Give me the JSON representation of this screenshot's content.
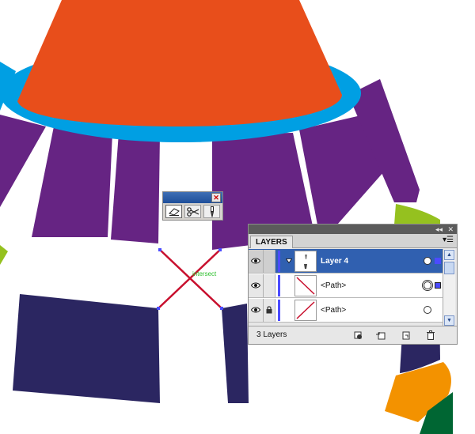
{
  "canvas": {
    "intersect_hint": "intersect",
    "colors": {
      "orange": "#e84e1b",
      "blue_ring": "#009fe3",
      "purple": "#662483",
      "navy": "#2b2661",
      "green": "#95c11f",
      "gold": "#f39200",
      "dark_green": "#006633",
      "crossed_lines": "#c8102e"
    }
  },
  "tool_panel": {
    "tools": [
      {
        "icon": "eraser-icon",
        "active": true
      },
      {
        "icon": "scissors-icon",
        "active": false
      },
      {
        "icon": "knife-icon",
        "active": false
      }
    ]
  },
  "layers_panel": {
    "tab": "LAYERS",
    "rows": [
      {
        "name": "Layer 4",
        "selected": true
      },
      {
        "name": "<Path>",
        "selected": false
      },
      {
        "name": "<Path>",
        "selected": false
      }
    ],
    "count": "3 Layers"
  }
}
